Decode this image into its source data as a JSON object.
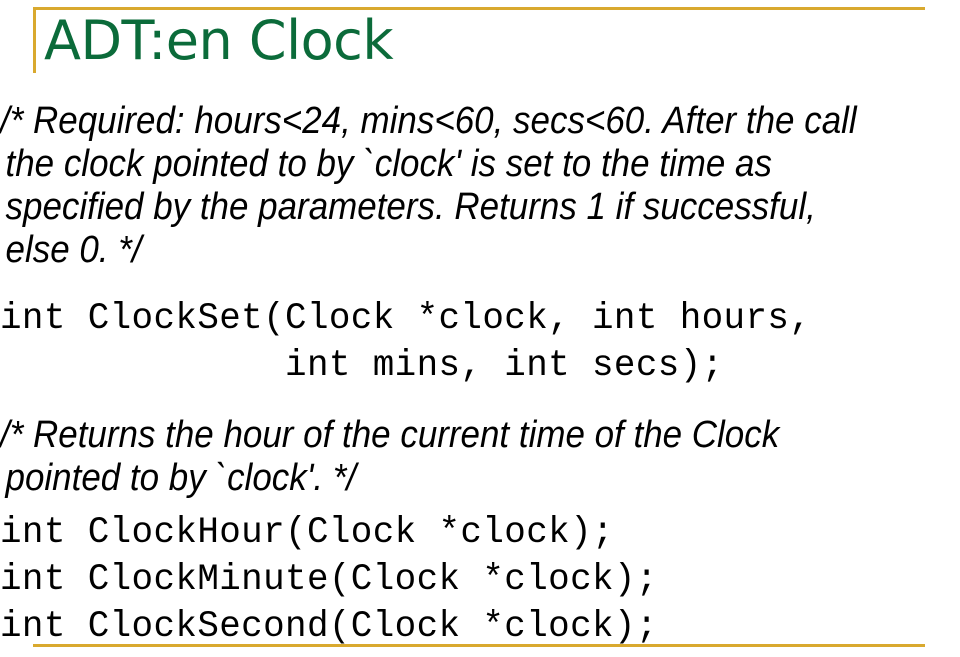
{
  "slide": {
    "title": "ADT:en Clock",
    "title_color": "#0B6B3A",
    "accent_color": "#D9A92E",
    "background_color": "#FFFFFF",
    "text_color": "#000000"
  },
  "content": {
    "comment_1": "/* Required: hours<24, mins<60, secs<60. After the call the clock pointed to by `clock' is set to the time as specified by the parameters. Returns 1 if successful, else 0. */",
    "code_1_line_1": "int ClockSet(Clock *clock, int hours,",
    "code_1_line_2": "             int mins, int secs);",
    "comment_2": "/* Returns the hour of the current time of the Clock pointed to by `clock'. */",
    "code_2_line_1": "int ClockHour(Clock *clock);",
    "code_2_line_2": "int ClockMinute(Clock *clock);",
    "code_2_line_3": "int ClockSecond(Clock *clock);"
  }
}
